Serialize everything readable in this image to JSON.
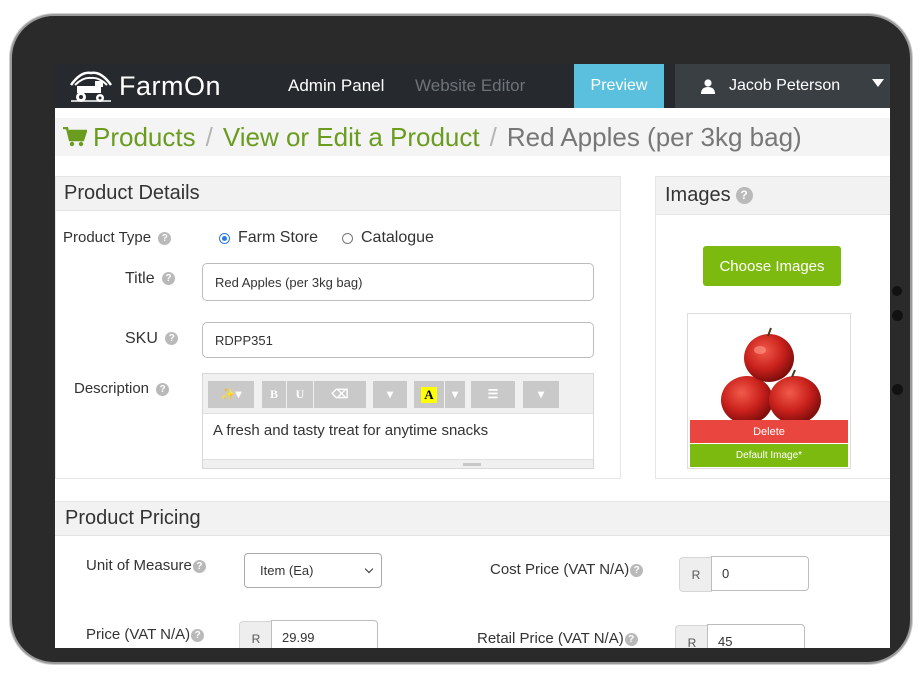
{
  "navbar": {
    "logo_text": "FarmOn",
    "admin_panel": "Admin Panel",
    "website_editor": "Website Editor",
    "preview": "Preview",
    "user_name": "Jacob Peterson"
  },
  "breadcrumb": {
    "products": "Products",
    "separator": "/",
    "view_edit": "View or Edit a Product",
    "current": "Red Apples (per 3kg bag)"
  },
  "product_details": {
    "heading": "Product Details",
    "product_type_label": "Product Type",
    "option_farm_store": "Farm Store",
    "option_catalogue": "Catalogue",
    "selected_option": "Farm Store",
    "title_label": "Title",
    "title_value": "Red Apples (per 3kg bag)",
    "sku_label": "SKU",
    "sku_value": "RDPP351",
    "description_label": "Description",
    "description_value": "A fresh and tasty treat for anytime snacks"
  },
  "editor_toolbar": {
    "magic": "✨▾",
    "bold": "B",
    "underline": "U",
    "eraser": "⌫",
    "dropdown": "▾",
    "highlight": "A",
    "list": "☰"
  },
  "images": {
    "heading": "Images",
    "choose_images": "Choose Images",
    "delete": "Delete",
    "default_image": "Default Image*"
  },
  "pricing": {
    "heading": "Product Pricing",
    "unit_label": "Unit of Measure",
    "unit_value": "Item (Ea)",
    "cost_label": "Cost Price (VAT N/A)",
    "cost_value": "0",
    "price_label": "Price (VAT N/A)",
    "price_value": "29.99",
    "retail_label": "Retail Price (VAT N/A)",
    "retail_value": "45",
    "currency": "R"
  },
  "colors": {
    "brand_green": "#7dba0f",
    "breadcrumb_green": "#6a9c1f",
    "preview_blue": "#5bc0de",
    "delete_red": "#e8463f",
    "navbar_dark": "#262a2e"
  }
}
